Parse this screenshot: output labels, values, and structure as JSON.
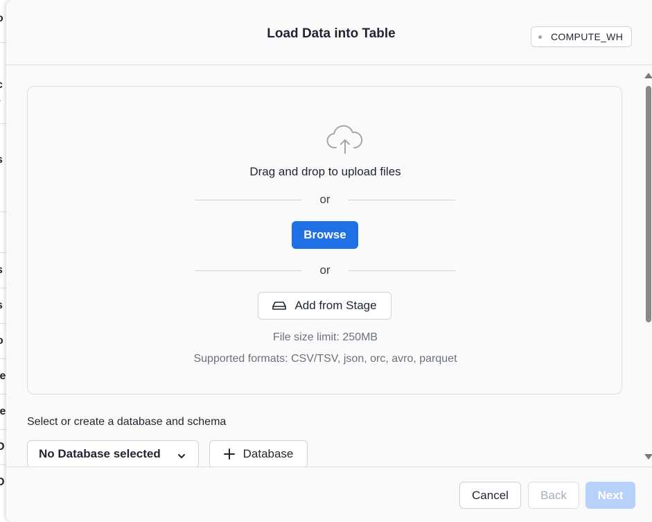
{
  "background_page": {
    "rows": [
      {
        "label": "o"
      },
      {
        "label": "c",
        "sub": "v"
      },
      {
        "label": "s"
      },
      {
        "label": ""
      },
      {
        "label": "s"
      },
      {
        "label": "s"
      },
      {
        "label": "o"
      },
      {
        "label": "le"
      },
      {
        "label": "le"
      },
      {
        "label": "D"
      },
      {
        "label": "D"
      }
    ]
  },
  "modal": {
    "title": "Load Data into Table",
    "warehouse": "COMPUTE_WH"
  },
  "upload": {
    "drag_text": "Drag and drop to upload files",
    "or_label": "or",
    "browse_label": "Browse",
    "stage_label": "Add from Stage",
    "file_size_limit": "File size limit: 250MB",
    "supported_formats": "Supported formats: CSV/TSV, json, orc, avro, parquet"
  },
  "database": {
    "section_label": "Select or create a database and schema",
    "selected_value": "No Database selected",
    "add_label": "Database"
  },
  "footer": {
    "cancel_label": "Cancel",
    "back_label": "Back",
    "next_label": "Next"
  },
  "colors": {
    "primary": "#1f6fe5",
    "primary_disabled": "#b6d2fb",
    "border": "#cfd2d8",
    "muted_text": "#6b717b"
  },
  "icons": {
    "upload": "cloud-upload-icon",
    "stage": "stage-drive-icon",
    "chevron": "chevron-down-icon",
    "plus": "plus-icon",
    "warehouse": "status-dot-icon"
  }
}
